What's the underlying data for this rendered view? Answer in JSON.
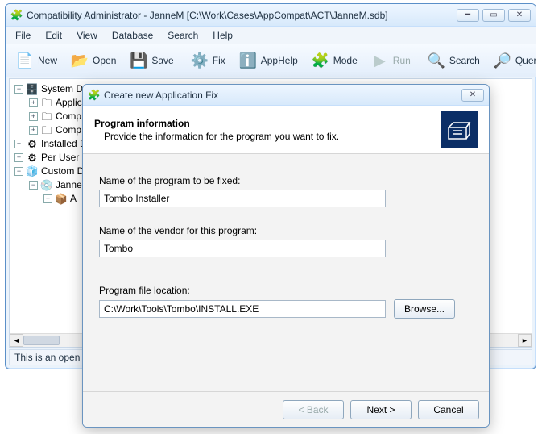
{
  "window": {
    "title": "Compatibility Administrator - JanneM [C:\\Work\\Cases\\AppCompat\\ACT\\JanneM.sdb]"
  },
  "menu": {
    "file": "File",
    "edit": "Edit",
    "view": "View",
    "database": "Database",
    "search": "Search",
    "help": "Help"
  },
  "toolbar": {
    "new": "New",
    "open": "Open",
    "save": "Save",
    "fix": "Fix",
    "apphelp": "AppHelp",
    "mode": "Mode",
    "run": "Run",
    "search": "Search",
    "query": "Query"
  },
  "tree": {
    "system_db": "System Database",
    "applications": "Applic",
    "compat_fixes": "Comp",
    "compat_modes": "Comp",
    "installed": "Installed D",
    "per_user": "Per User C",
    "custom": "Custom D",
    "jannem": "Janne",
    "app_a": "A"
  },
  "statusbar": {
    "text": "This is an open w"
  },
  "dialog": {
    "title": "Create new Application Fix",
    "heading": "Program information",
    "subheading": "Provide the information for the program you want to fix.",
    "label_name": "Name of the program to be fixed:",
    "value_name": "Tombo Installer",
    "label_vendor": "Name of the vendor for this program:",
    "value_vendor": "Tombo",
    "label_location": "Program file location:",
    "value_location": "C:\\Work\\Tools\\Tombo\\INSTALL.EXE",
    "browse": "Browse...",
    "back": "< Back",
    "next": "Next >",
    "cancel": "Cancel"
  },
  "icons": {
    "new": "📄",
    "open": "📂",
    "save": "💾",
    "fix": "⚙️",
    "apphelp": "ℹ️",
    "mode": "🧩",
    "run": "▶",
    "search": "🔍",
    "query": "🔎",
    "db": "🗄️",
    "folder": "🗀",
    "gear": "⚙",
    "cube": "🧊",
    "disc": "💿",
    "box": "📦"
  }
}
